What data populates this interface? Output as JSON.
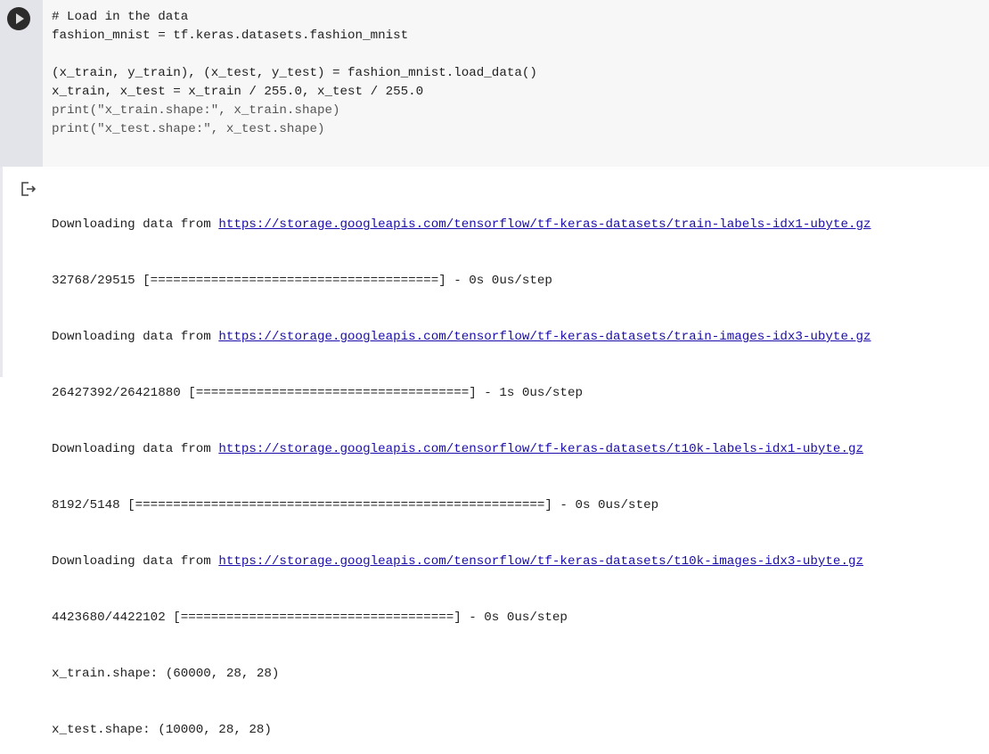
{
  "cell": {
    "run_button_label": "Run cell",
    "code_lines": [
      "# Load in the data",
      "fashion_mnist = tf.keras.datasets.fashion_mnist",
      "",
      "(x_train, y_train), (x_test, y_test) = fashion_mnist.load_data()",
      "x_train, x_test = x_train / 255.0, x_test / 255.0",
      "print(\"x_train.shape:\", x_train.shape)",
      "print(\"x_test.shape:\", x_test.shape)"
    ]
  },
  "output": {
    "downloads": [
      {
        "prefix": "Downloading data from ",
        "url": "https://storage.googleapis.com/tensorflow/tf-keras-datasets/train-labels-idx1-ubyte.gz",
        "progress": "32768/29515 [======================================] - 0s 0us/step"
      },
      {
        "prefix": "Downloading data from ",
        "url": "https://storage.googleapis.com/tensorflow/tf-keras-datasets/train-images-idx3-ubyte.gz",
        "progress": "26427392/26421880 [====================================] - 1s 0us/step"
      },
      {
        "prefix": "Downloading data from ",
        "url": "https://storage.googleapis.com/tensorflow/tf-keras-datasets/t10k-labels-idx1-ubyte.gz",
        "progress": "8192/5148 [======================================================] - 0s 0us/step"
      },
      {
        "prefix": "Downloading data from ",
        "url": "https://storage.googleapis.com/tensorflow/tf-keras-datasets/t10k-images-idx3-ubyte.gz",
        "progress": "4423680/4422102 [====================================] - 0s 0us/step"
      }
    ],
    "results": [
      "x_train.shape: (60000, 28, 28)",
      "x_test.shape: (10000, 28, 28)"
    ]
  }
}
